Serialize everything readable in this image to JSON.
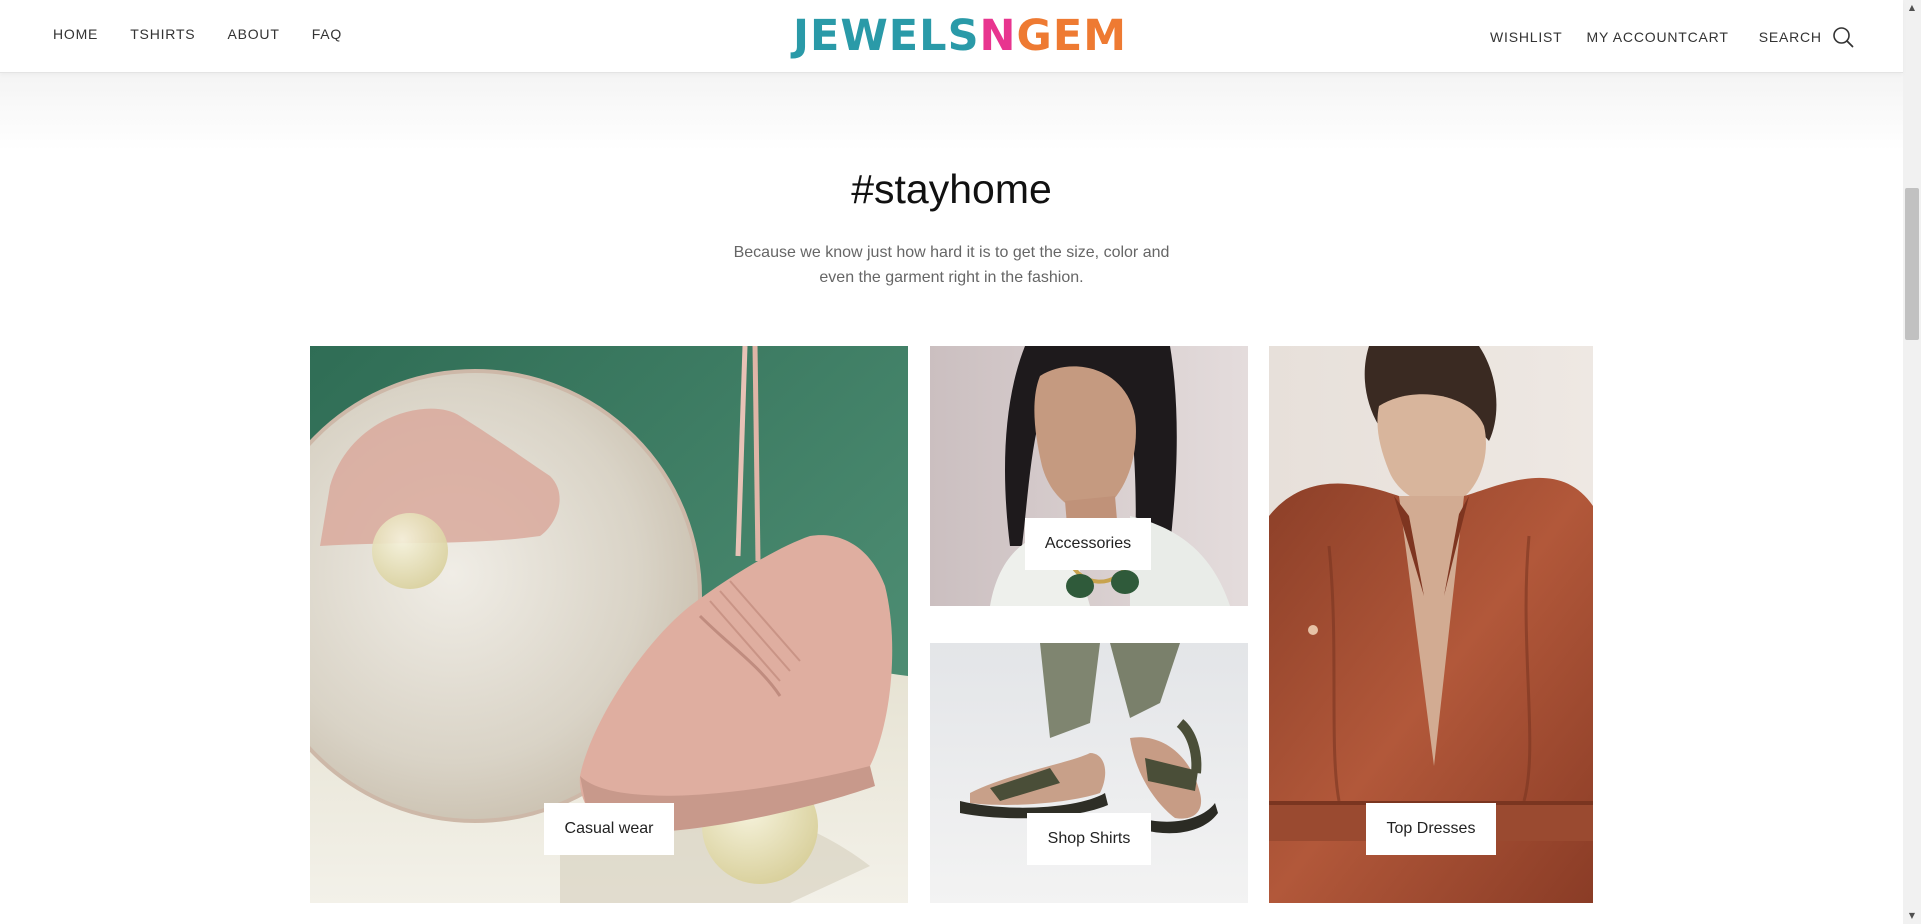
{
  "header": {
    "nav_left": [
      "HOME",
      "TSHIRTS",
      "ABOUT",
      "FAQ"
    ],
    "logo": {
      "parts": [
        {
          "text": "JEWELS",
          "color": "#2a9aa8"
        },
        {
          "text": "N",
          "color": "#e8358f"
        },
        {
          "text": "GEM",
          "color": "#ee7a32"
        }
      ]
    },
    "wishlist_label": "WISHLIST",
    "account_label": "MY ACCOUNT",
    "cart_label": "CART",
    "search_label": "SEARCH",
    "search_icon": "search-icon"
  },
  "section": {
    "title": "#stayhome",
    "description": "Because we know just how hard it is to get the size, color and even the garment right in the fashion."
  },
  "tiles": [
    {
      "label": "Casual wear",
      "image": "pink-sneaker-with-mirror"
    },
    {
      "label": "Accessories",
      "image": "woman-with-green-necklace"
    },
    {
      "label": "Shop Shirts",
      "image": "olive-sandals"
    },
    {
      "label": "Top Dresses",
      "image": "woman-in-rust-shirt-dress"
    }
  ],
  "colors": {
    "brand_teal": "#2a9aa8",
    "brand_pink": "#e8358f",
    "brand_orange": "#ee7a32",
    "sneaker_bg_green": "#3f7a62",
    "dress_rust": "#a65237"
  }
}
